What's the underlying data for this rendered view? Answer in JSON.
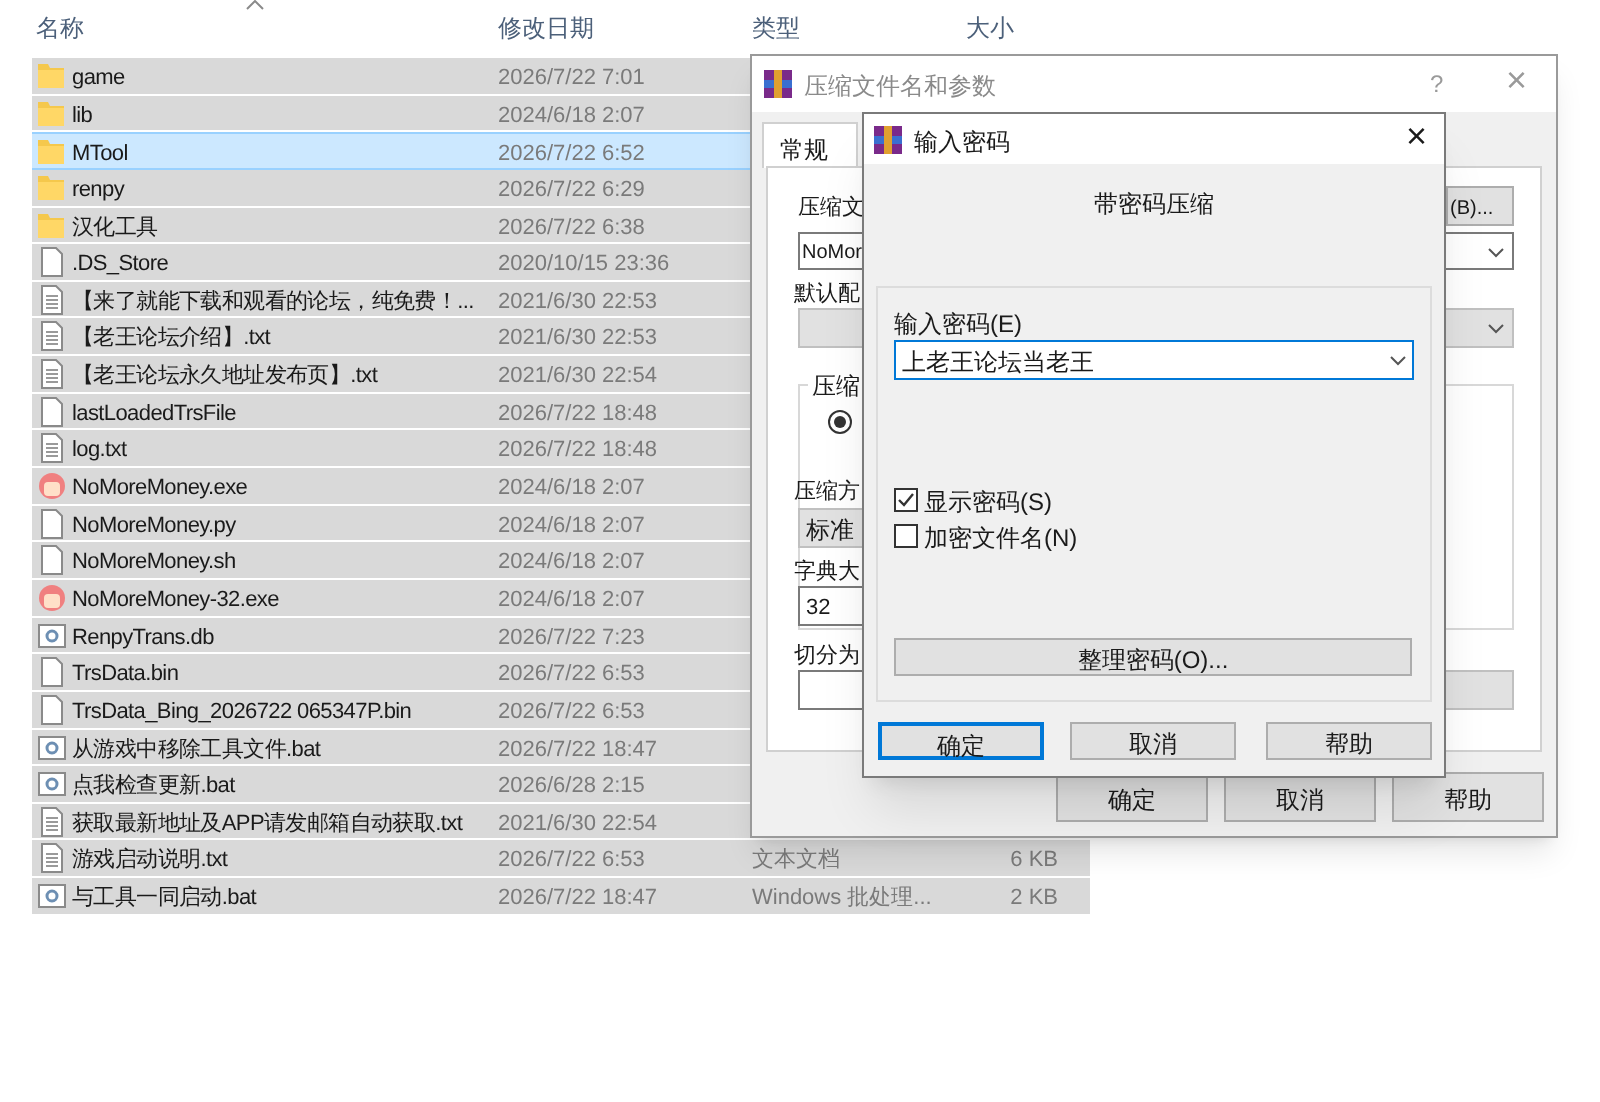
{
  "explorer": {
    "columns": [
      {
        "label": "名称",
        "sorted": true
      },
      {
        "label": "修改日期",
        "sorted": false
      },
      {
        "label": "类型",
        "sorted": false
      },
      {
        "label": "大小",
        "sorted": false
      }
    ],
    "rows": [
      {
        "kind": "folder",
        "name": "game",
        "date": "2026/7/22 7:01",
        "selected": false
      },
      {
        "kind": "folder",
        "name": "lib",
        "date": "2024/6/18 2:07",
        "selected": false
      },
      {
        "kind": "folder",
        "name": "MTool",
        "date": "2026/7/22 6:52",
        "selected": true
      },
      {
        "kind": "folder",
        "name": "renpy",
        "date": "2026/7/22 6:29",
        "selected": false
      },
      {
        "kind": "folder",
        "name": "汉化工具",
        "date": "2026/7/22 6:38",
        "selected": false
      },
      {
        "kind": "file",
        "name": ".DS_Store",
        "date": "2020/10/15 23:36",
        "selected": false
      },
      {
        "kind": "text",
        "name": "【来了就能下载和观看的论坛，纯免费！...",
        "date": "2021/6/30 22:53",
        "selected": false
      },
      {
        "kind": "text",
        "name": "【老王论坛介绍】.txt",
        "date": "2021/6/30 22:53",
        "selected": false
      },
      {
        "kind": "text",
        "name": "【老王论坛永久地址发布页】.txt",
        "date": "2021/6/30 22:54",
        "selected": false
      },
      {
        "kind": "file",
        "name": "lastLoadedTrsFile",
        "date": "2026/7/22 18:48",
        "selected": false
      },
      {
        "kind": "text",
        "name": "log.txt",
        "date": "2026/7/22 18:48",
        "selected": false
      },
      {
        "kind": "exe",
        "name": "NoMoreMoney.exe",
        "date": "2024/6/18 2:07",
        "selected": false
      },
      {
        "kind": "file",
        "name": "NoMoreMoney.py",
        "date": "2024/6/18 2:07",
        "selected": false
      },
      {
        "kind": "file",
        "name": "NoMoreMoney.sh",
        "date": "2024/6/18 2:07",
        "selected": false
      },
      {
        "kind": "exe",
        "name": "NoMoreMoney-32.exe",
        "date": "2024/6/18 2:07",
        "selected": false
      },
      {
        "kind": "batch",
        "name": "RenpyTrans.db",
        "date": "2026/7/22 7:23",
        "selected": false
      },
      {
        "kind": "file",
        "name": "TrsData.bin",
        "date": "2026/7/22 6:53",
        "selected": false
      },
      {
        "kind": "file",
        "name": "TrsData_Bing_2026722 065347P.bin",
        "date": "2026/7/22 6:53",
        "selected": false
      },
      {
        "kind": "batch",
        "name": "从游戏中移除工具文件.bat",
        "date": "2026/7/22 18:47",
        "selected": false
      },
      {
        "kind": "batch",
        "name": "点我检查更新.bat",
        "date": "2026/6/28 2:15",
        "selected": false
      },
      {
        "kind": "text",
        "name": "获取最新地址及APP请发邮箱自动获取.txt",
        "date": "2021/6/30 22:54",
        "selected": false
      },
      {
        "kind": "text",
        "name": "游戏启动说明.txt",
        "date": "2026/7/22 6:53",
        "type": "文本文档",
        "size": "6 KB",
        "selected": false
      },
      {
        "kind": "batch",
        "name": "与工具一同启动.bat",
        "date": "2026/7/22 18:47",
        "type": "Windows 批处理...",
        "size": "2 KB",
        "selected": false
      }
    ]
  },
  "archive_dialog": {
    "title": "压缩文件名和参数",
    "help": "?",
    "close": "×",
    "tab": "常规",
    "archive_label": "压缩文",
    "archive_value": "NoMor",
    "browse_button": "(B)...",
    "profile_label": "默认配",
    "format_label": "压缩",
    "radio": {
      "checked": true
    },
    "method_label": "压缩方",
    "method_value": "标准",
    "dict_label": "字典大",
    "dict_value": "32",
    "split_label": "切分为",
    "buttons": [
      "确定",
      "取消",
      "帮助"
    ]
  },
  "password_dialog": {
    "title": "输入密码",
    "close": "×",
    "heading": "带密码压缩",
    "password_label": "输入密码(E)",
    "password_value": "上老王论坛当老王",
    "options": [
      {
        "label": "显示密码(S)",
        "checked": true
      },
      {
        "label": "加密文件名(N)",
        "checked": false
      }
    ],
    "organize_button": "整理密码(O)...",
    "buttons": [
      {
        "label": "确定",
        "default": true
      },
      {
        "label": "取消",
        "default": false
      },
      {
        "label": "帮助",
        "default": false
      }
    ]
  }
}
